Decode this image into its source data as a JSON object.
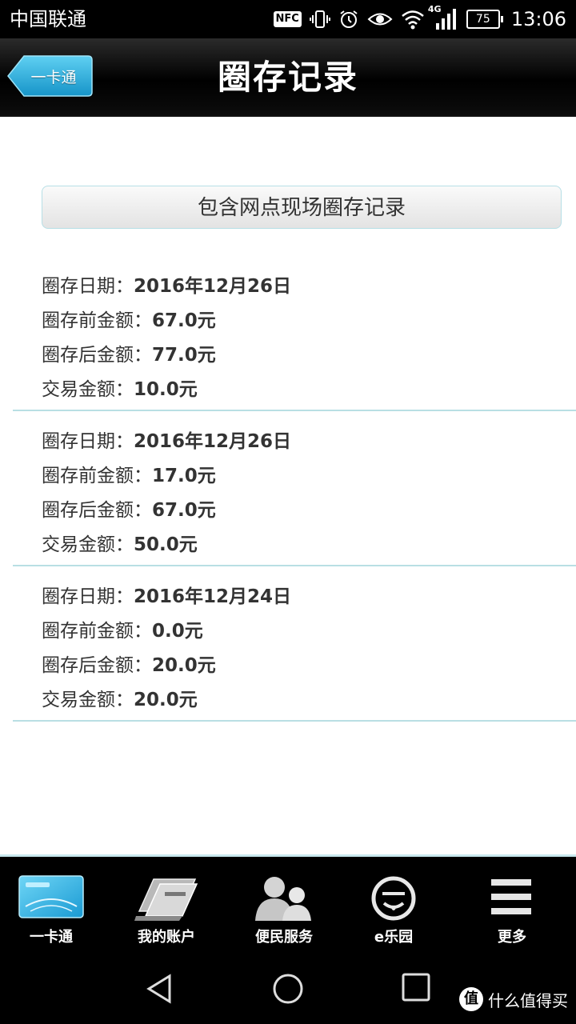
{
  "status_bar": {
    "carrier": "中国联通",
    "nfc": "NFC",
    "network": "4G",
    "battery": "75",
    "time": "13:06"
  },
  "header": {
    "back_label": "一卡通",
    "title": "圈存记录"
  },
  "filter_button": "包含网点现场圈存记录",
  "labels": {
    "date": "圈存日期：",
    "before": "圈存前金额：",
    "after": "圈存后金额：",
    "amount": "交易金额："
  },
  "records": [
    {
      "date": "2016年12月26日",
      "before": "67.0元",
      "after": "77.0元",
      "amount": "10.0元"
    },
    {
      "date": "2016年12月26日",
      "before": "17.0元",
      "after": "67.0元",
      "amount": "50.0元"
    },
    {
      "date": "2016年12月24日",
      "before": "0.0元",
      "after": "20.0元",
      "amount": "20.0元"
    }
  ],
  "tabs": [
    {
      "label": "一卡通",
      "icon": "card-icon"
    },
    {
      "label": "我的账户",
      "icon": "account-icon"
    },
    {
      "label": "便民服务",
      "icon": "people-icon"
    },
    {
      "label": "e乐园",
      "icon": "smiley-icon"
    },
    {
      "label": "更多",
      "icon": "menu-icon"
    }
  ],
  "watermark": {
    "badge": "值",
    "text": "什么值得买"
  },
  "colors": {
    "accent": "#2fb7e6",
    "divider": "#b9dfe4",
    "bar": "#000000"
  }
}
